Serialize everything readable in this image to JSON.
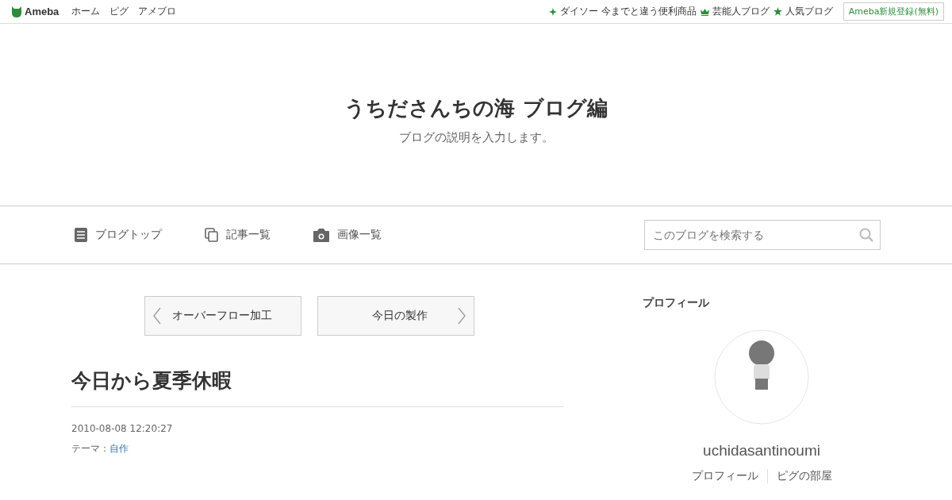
{
  "header": {
    "logo": "Ameba",
    "nav": [
      "ホーム",
      "ピグ",
      "アメブロ"
    ],
    "links": [
      {
        "kind": "sparkle",
        "label": "ダイソー 今までと違う便利商品"
      },
      {
        "kind": "crown",
        "label": "芸能人ブログ"
      },
      {
        "kind": "star",
        "label": "人気ブログ"
      }
    ],
    "signup": "Ameba新規登録(無料)"
  },
  "blog": {
    "title": "うちださんちの海 ブログ編",
    "description": "ブログの説明を入力します。"
  },
  "menu": [
    {
      "kind": "doc",
      "label": "ブログトップ"
    },
    {
      "kind": "copy",
      "label": "記事一覧"
    },
    {
      "kind": "camera",
      "label": "画像一覧"
    }
  ],
  "search": {
    "placeholder": "このブログを検索する"
  },
  "pager": {
    "prev": "オーバーフロー加工",
    "next": "今日の製作"
  },
  "article": {
    "title": "今日から夏季休暇",
    "date": "2010-08-08 12:20:27",
    "theme_label": "テーマ：",
    "theme": "自作"
  },
  "profile": {
    "heading": "プロフィール",
    "name": "uchidasantinoumi",
    "links": [
      "プロフィール",
      "ピグの部屋"
    ]
  }
}
